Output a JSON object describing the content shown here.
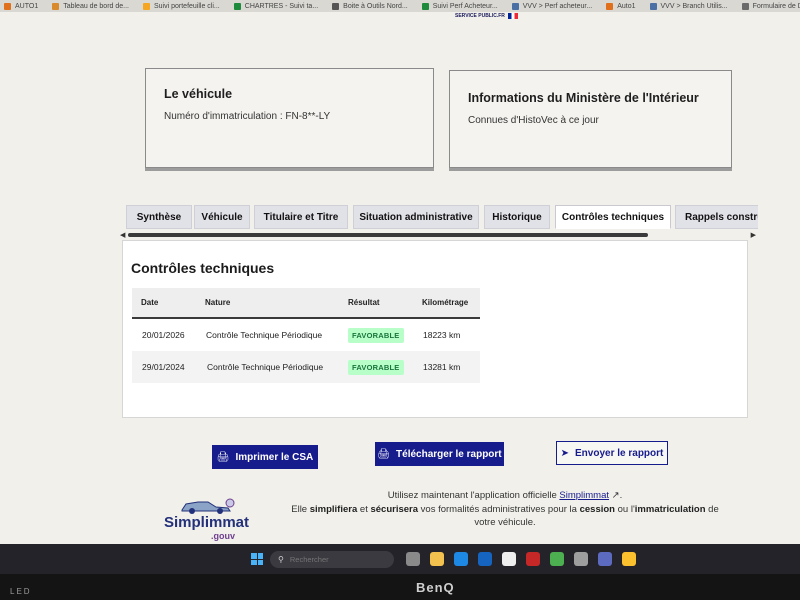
{
  "bookmarks": [
    {
      "label": "AUTO1",
      "color": "#e0701c"
    },
    {
      "label": "Tableau de bord de...",
      "color": "#d98a2b"
    },
    {
      "label": "Suivi portefeuille cli...",
      "color": "#f5a623"
    },
    {
      "label": "CHARTRES - Suivi ta...",
      "color": "#1e8a3c"
    },
    {
      "label": "Boite à Outils Nord...",
      "color": "#555555"
    },
    {
      "label": "Suivi Perf Acheteur...",
      "color": "#1e8a3c"
    },
    {
      "label": "VVV > Perf acheteur...",
      "color": "#4a6fa5"
    },
    {
      "label": "Auto1",
      "color": "#e0701c"
    },
    {
      "label": "VVV > Branch Utilis...",
      "color": "#4a6fa5"
    },
    {
      "label": "Formulaire de Dem...",
      "color": "#6a6a6a"
    }
  ],
  "header": {
    "logo_text": "SERVICE PUBLIC.FR"
  },
  "vehicle_card": {
    "title": "Le véhicule",
    "registration": "Numéro d'immatriculation : FN-8**-LY"
  },
  "ministry_card": {
    "title": "Informations du Ministère de l'Intérieur",
    "subtitle": "Connues d'HistoVec à ce jour"
  },
  "tabs": [
    {
      "label": "Synthèse",
      "active": false
    },
    {
      "label": "Véhicule",
      "active": false
    },
    {
      "label": "Titulaire et Titre",
      "active": false
    },
    {
      "label": "Situation administrative",
      "active": false
    },
    {
      "label": "Historique",
      "active": false
    },
    {
      "label": "Contrôles techniques",
      "active": true
    },
    {
      "label": "Rappels constructeur",
      "active": false
    }
  ],
  "scroll": {
    "left_arrow": "◀",
    "right_arrow": "▶"
  },
  "panel": {
    "title": "Contrôles techniques",
    "headers": {
      "date": "Date",
      "nature": "Nature",
      "result": "Résultat",
      "mileage": "Kilométrage"
    },
    "rows": [
      {
        "date": "20/01/2026",
        "nature": "Contrôle Technique Périodique",
        "result": "FAVORABLE",
        "mileage": "18223 km"
      },
      {
        "date": "29/01/2024",
        "nature": "Contrôle Technique Périodique",
        "result": "FAVORABLE",
        "mileage": "13281 km"
      }
    ]
  },
  "actions": {
    "print": "Imprimer le CSA",
    "download": "Télécharger le rapport",
    "send": "Envoyer le rapport"
  },
  "promo": {
    "brand": "Simplimmat",
    "brand_sub": ".gouv",
    "line1_prefix": "Utilisez maintenant l'application officielle",
    "link": "Simplimmat",
    "line1_suffix": ".",
    "line2_a": "Elle",
    "line2_b": "simplifiera",
    "line2_c": "et",
    "line2_d": "sécurisera",
    "line2_e": "vos formalités administratives pour la",
    "line2_f": "cession",
    "line2_g": "ou l'",
    "line2_h": "immatriculation",
    "line2_i": "de",
    "line3": "votre véhicule."
  },
  "taskbar": {
    "search_placeholder": "Rechercher",
    "apps": [
      "#8a8a8a",
      "#f2c14e",
      "#1e88e5",
      "#1565c0",
      "#eeeeee",
      "#c62828",
      "#4caf50",
      "#9e9e9e",
      "#5c6bc0",
      "#fbc02d"
    ]
  },
  "monitor": {
    "brand": "BenQ",
    "led_label": "LED"
  }
}
